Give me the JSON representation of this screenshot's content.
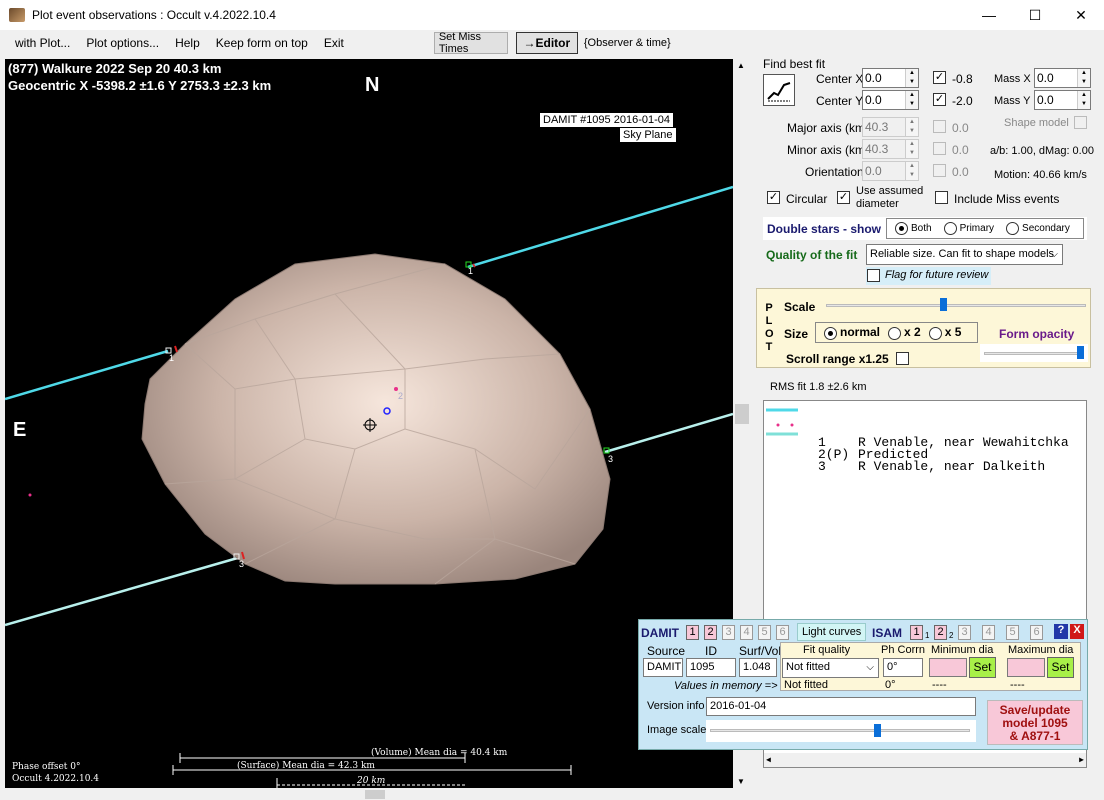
{
  "window": {
    "title": "Plot event observations : Occult v.4.2022.10.4",
    "controls": {
      "minimize": "—",
      "maximize": "☐",
      "close": "✕"
    }
  },
  "menu": {
    "items": [
      "with Plot...",
      "Plot options...",
      "Help",
      "Keep form on top",
      "Exit"
    ],
    "set_miss_times": "Set Miss Times",
    "editor": "→Editor",
    "observer_time": "{Observer & time}"
  },
  "plot": {
    "header_line1": "(877) Walkure  2022 Sep 20   40.3 km",
    "header_line2": "Geocentric  X  -5398.2 ±1.6  Y 2753.3 ±2.3 km",
    "north": "N",
    "east": "E",
    "damit_label": "DAMIT #1095 2016-01-04",
    "sky_plane": "Sky Plane",
    "chord_labels": [
      "1",
      "1",
      "2",
      "3",
      "3"
    ],
    "volume_dia": "(Volume) Mean dia = 40.4 km",
    "surface_dia": "(Surface) Mean dia = 42.3 km",
    "scale_km": "20 km",
    "phase_offset": "Phase offset 0°",
    "version": "Occult 4.2022.10.4"
  },
  "fit": {
    "title": "Find best fit",
    "center_x_label": "Center X",
    "center_x": "0.0",
    "center_y_label": "Center Y",
    "center_y": "0.0",
    "chk_x_value": "-0.8",
    "chk_y_value": "-2.0",
    "mass_x_label": "Mass X",
    "mass_x": "0.0",
    "mass_y_label": "Mass Y",
    "mass_y": "0.0",
    "major_label": "Major axis (km)",
    "major": "40.3",
    "minor_label": "Minor axis (km)",
    "minor": "40.3",
    "orient_label": "Orientation",
    "orient": "0.0",
    "dis_val1": "0.0",
    "dis_val2": "0.0",
    "dis_val3": "0.0",
    "shape_model": "Shape model",
    "ab_dmag": "a/b: 1.00, dMag: 0.00",
    "motion": "Motion: 40.66 km/s",
    "circular": "Circular",
    "use_assumed": "Use assumed",
    "diameter": "diameter",
    "include_miss": "Include Miss events"
  },
  "double_stars": {
    "label": "Double stars - show",
    "options": [
      "Both",
      "Primary",
      "Secondary"
    ]
  },
  "quality": {
    "label": "Quality of the fit",
    "value": "Reliable size. Can fit to shape models",
    "flag": "Flag for future review"
  },
  "plotbox": {
    "letters": [
      "P",
      "L",
      "O",
      "T"
    ],
    "scale": "Scale",
    "size": "Size",
    "size_options": [
      "normal",
      "x 2",
      "x 5"
    ],
    "form_opacity": "Form opacity",
    "scroll_range": "Scroll range x1.25",
    "scale_level": 0.45,
    "opacity_level": 0.97
  },
  "rms": "RMS fit  1.8 ±2.6 km",
  "legend": [
    {
      "num": "1",
      "text": "R Venable, near Wewahitchka",
      "color": "#4fd9e8"
    },
    {
      "num": "2(P)",
      "text": "Predicted",
      "color": "#e8308a"
    },
    {
      "num": "3",
      "text": "R Venable, near Dalkeith",
      "color": "#7fe0d8"
    }
  ],
  "damit": {
    "title": "DAMIT",
    "nums": [
      "1",
      "2",
      "3",
      "4",
      "5",
      "6"
    ],
    "light_curves": "Light curves",
    "isam": "ISAM",
    "isam_nums": [
      "1",
      "1",
      "2",
      "2",
      "3",
      "4",
      "5",
      "6"
    ],
    "help": "?",
    "close": "X",
    "source_h": "Source",
    "id_h": "ID",
    "surfvol_h": "Surf/Vol",
    "fit_h": "Fit quality",
    "ph_h": "Ph Corrn",
    "min_h": "Minimum dia",
    "max_h": "Maximum dia",
    "source": "DAMIT",
    "id": "1095",
    "surfvol": "1.048",
    "fit": "Not fitted",
    "ph": "0°",
    "set": "Set",
    "values_label": "Values in memory =>",
    "mem_fit": "Not fitted",
    "mem_ph": "0°",
    "mem_min": "----",
    "mem_max": "----",
    "version_label": "Version info",
    "version": "2016-01-04",
    "image_scale": "Image scale",
    "image_scale_level": 0.65,
    "save": "Save/update\nmodel 1095\n& A877-1"
  }
}
